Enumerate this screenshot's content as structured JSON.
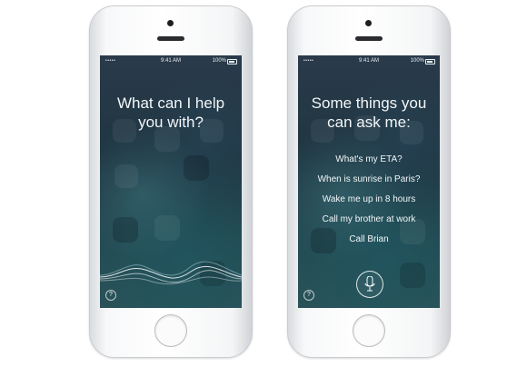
{
  "status_bar": {
    "signal": "•••••",
    "time": "9:41 AM",
    "battery": "100%"
  },
  "phone_left": {
    "headline_line1": "What can I help",
    "headline_line2": "you with?",
    "help_label": "?"
  },
  "phone_right": {
    "headline_line1": "Some things you",
    "headline_line2": "can ask me:",
    "suggestions": [
      "What's my ETA?",
      "When is sunrise in Paris?",
      "Wake me up in 8 hours",
      "Call my brother at work",
      "Call Brian"
    ],
    "help_label": "?"
  },
  "icons": {
    "help": "question-icon",
    "microphone": "microphone-icon",
    "wave": "voice-wave-icon",
    "wifi": "wifi-icon",
    "battery": "battery-icon"
  }
}
